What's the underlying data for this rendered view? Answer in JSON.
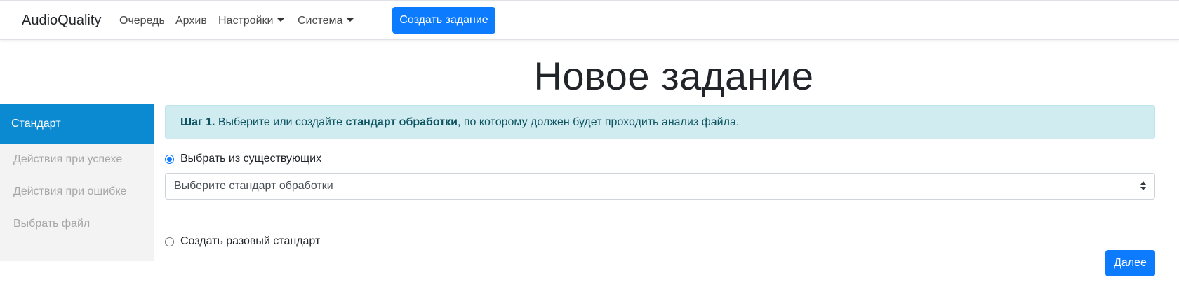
{
  "navbar": {
    "brand": "AudioQuality",
    "links": [
      "Очередь",
      "Архив",
      "Настройки",
      "Система"
    ],
    "create_button": "Создать задание"
  },
  "page": {
    "title": "Новое задание"
  },
  "sidebar": {
    "items": [
      {
        "label": "Стандарт",
        "active": true
      },
      {
        "label": "Действия при успехе",
        "active": false
      },
      {
        "label": "Действия при ошибке",
        "active": false
      },
      {
        "label": "Выбрать файл",
        "active": false
      }
    ]
  },
  "step": {
    "prefix": "Шаг 1.",
    "text_before": " Выберите или создайте ",
    "bold_text": "стандарт обработки",
    "text_after": ", по которому должен будет проходить анализ файла."
  },
  "form": {
    "option_existing": {
      "label": "Выбрать из существующих",
      "checked": true
    },
    "select_placeholder": "Выберите стандарт обработки",
    "option_oneoff": {
      "label": "Создать разовый стандарт",
      "checked": false
    },
    "next_button": "Далее"
  },
  "colors": {
    "primary": "#0d7bfe",
    "sidebar_active": "#0b8ad2",
    "alert_bg": "#d1ecf1",
    "alert_text": "#0c5460"
  }
}
